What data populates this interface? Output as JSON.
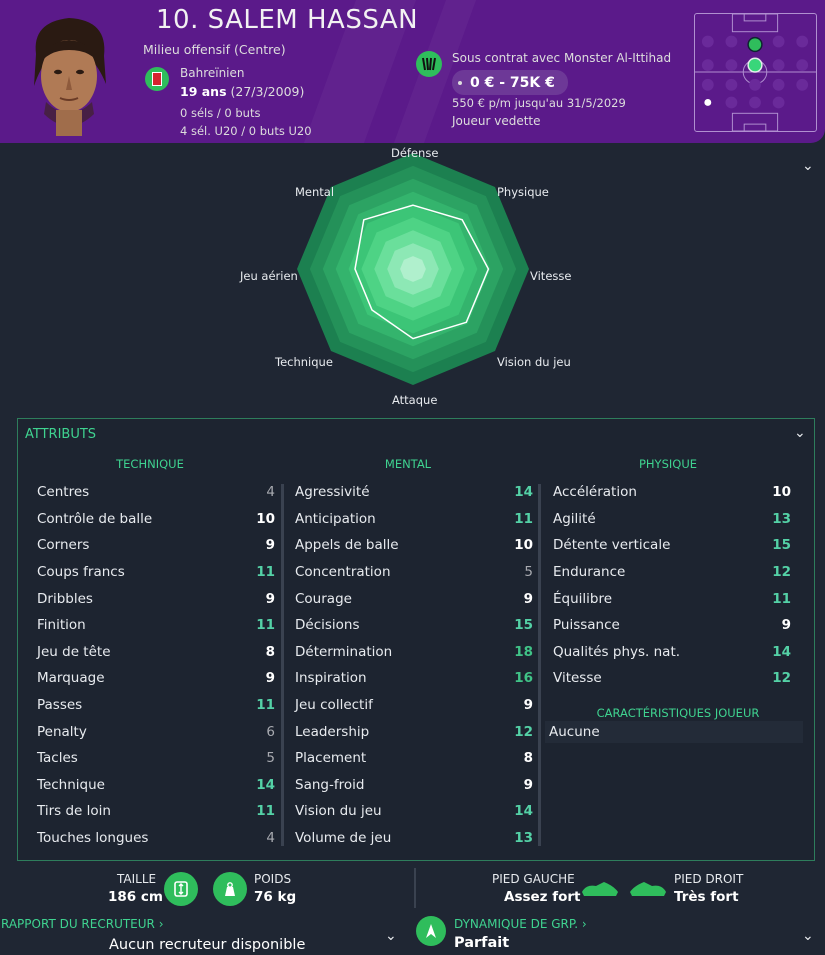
{
  "header": {
    "name": "10. SALEM HASSAN",
    "position": "Milieu offensif (Centre)",
    "nationality": "Bahreïnien",
    "age": "19 ans",
    "dob": "(27/3/2009)",
    "caps": "0 séls / 0 buts",
    "caps_u20": "4 sél. U20 / 0 buts U20",
    "contract": "Sous contrat avec Monster Al-Ittihad",
    "value": "0 € - 75K €",
    "wage": "550 € p/m jusqu'au 31/5/2029",
    "role": "Joueur vedette",
    "colors": {
      "header_bg": "#5b1a8a",
      "accent": "#2fbd5c"
    }
  },
  "radar": {
    "labels": [
      "Défense",
      "Physique",
      "Vitesse",
      "Vision du jeu",
      "Attaque",
      "Technique",
      "Jeu aérien",
      "Mental"
    ],
    "values": [
      11,
      12,
      13,
      13,
      12,
      10,
      10,
      12
    ],
    "max": 20
  },
  "attributes": {
    "title": "ATTRIBUTS",
    "technique": {
      "title": "TECHNIQUE",
      "items": [
        {
          "label": "Centres",
          "value": "4"
        },
        {
          "label": "Contrôle de balle",
          "value": "10"
        },
        {
          "label": "Corners",
          "value": "9"
        },
        {
          "label": "Coups francs",
          "value": "11"
        },
        {
          "label": "Dribbles",
          "value": "9"
        },
        {
          "label": "Finition",
          "value": "11"
        },
        {
          "label": "Jeu de tête",
          "value": "8"
        },
        {
          "label": "Marquage",
          "value": "9"
        },
        {
          "label": "Passes",
          "value": "11"
        },
        {
          "label": "Penalty",
          "value": "6"
        },
        {
          "label": "Tacles",
          "value": "5"
        },
        {
          "label": "Technique",
          "value": "14"
        },
        {
          "label": "Tirs de loin",
          "value": "11"
        },
        {
          "label": "Touches longues",
          "value": "4"
        }
      ]
    },
    "mental": {
      "title": "MENTAL",
      "items": [
        {
          "label": "Agressivité",
          "value": "14"
        },
        {
          "label": "Anticipation",
          "value": "11"
        },
        {
          "label": "Appels de balle",
          "value": "10"
        },
        {
          "label": "Concentration",
          "value": "5"
        },
        {
          "label": "Courage",
          "value": "9"
        },
        {
          "label": "Décisions",
          "value": "15"
        },
        {
          "label": "Détermination",
          "value": "18"
        },
        {
          "label": "Inspiration",
          "value": "16"
        },
        {
          "label": "Jeu collectif",
          "value": "9"
        },
        {
          "label": "Leadership",
          "value": "12"
        },
        {
          "label": "Placement",
          "value": "8"
        },
        {
          "label": "Sang-froid",
          "value": "9"
        },
        {
          "label": "Vision du jeu",
          "value": "14"
        },
        {
          "label": "Volume de jeu",
          "value": "13"
        }
      ]
    },
    "physique": {
      "title": "PHYSIQUE",
      "items": [
        {
          "label": "Accélération",
          "value": "10"
        },
        {
          "label": "Agilité",
          "value": "13"
        },
        {
          "label": "Détente verticale",
          "value": "15"
        },
        {
          "label": "Endurance",
          "value": "12"
        },
        {
          "label": "Équilibre",
          "value": "11"
        },
        {
          "label": "Puissance",
          "value": "9"
        },
        {
          "label": "Qualités phys. nat.",
          "value": "14"
        },
        {
          "label": "Vitesse",
          "value": "12"
        }
      ]
    },
    "characteristics": {
      "title": "CARACTÉRISTIQUES JOUEUR",
      "value": "Aucune"
    }
  },
  "bottom": {
    "height_label": "TAILLE",
    "height_value": "186 cm",
    "weight_label": "POIDS",
    "weight_value": "76 kg",
    "left_foot_label": "PIED GAUCHE",
    "left_foot_value": "Assez fort",
    "right_foot_label": "PIED DROIT",
    "right_foot_value": "Très fort",
    "scout_link": "RAPPORT DU RECRUTEUR ›",
    "scout_value": "Aucun recruteur disponible",
    "dynamics_link": "DYNAMIQUE DE GRP. ›",
    "dynamics_value": "Parfait"
  }
}
